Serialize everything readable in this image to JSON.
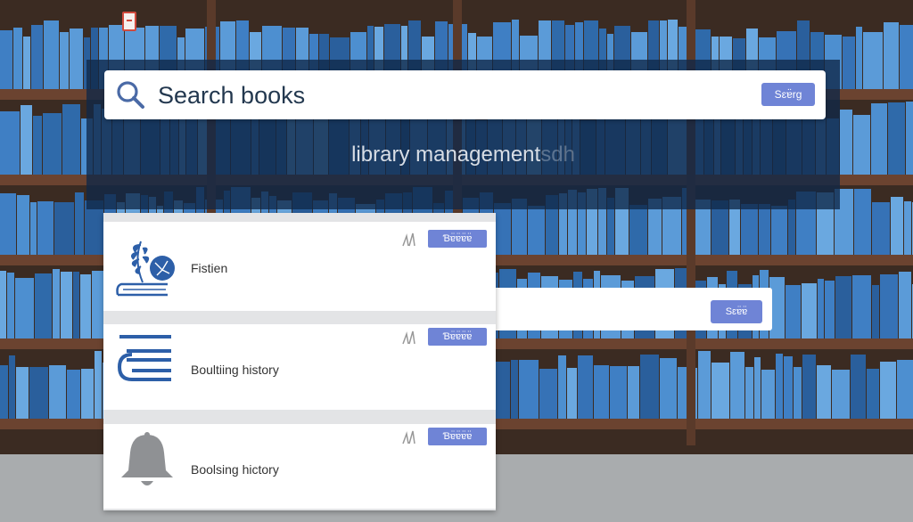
{
  "search": {
    "placeholder": "Search books",
    "button_label": "Sɛɐ̈rg"
  },
  "header": {
    "subtitle": "library management",
    "subtitle_ghost": "sdh"
  },
  "side_card": {
    "button_label": "Sɛɐ̈ɐ̈"
  },
  "list": {
    "items": [
      {
        "label": "Fistien",
        "badge": "Ɓɐ̈ɐ̈ɐ̈ɐ̈",
        "icon": "book-leaf-icon"
      },
      {
        "label": "Boultiing history",
        "badge": "Ɓɐ̈ɐ̈ɐ̈ɐ̈",
        "icon": "books-stack-icon"
      },
      {
        "label": "Boolsing hictory",
        "badge": "Ɓɐ̈ɐ̈ɐ̈ɐ̈",
        "icon": "bell-icon"
      }
    ]
  },
  "colors": {
    "accent": "#6f84d6",
    "header_overlay": "#10284a",
    "icon_blue": "#2d5fa8"
  }
}
